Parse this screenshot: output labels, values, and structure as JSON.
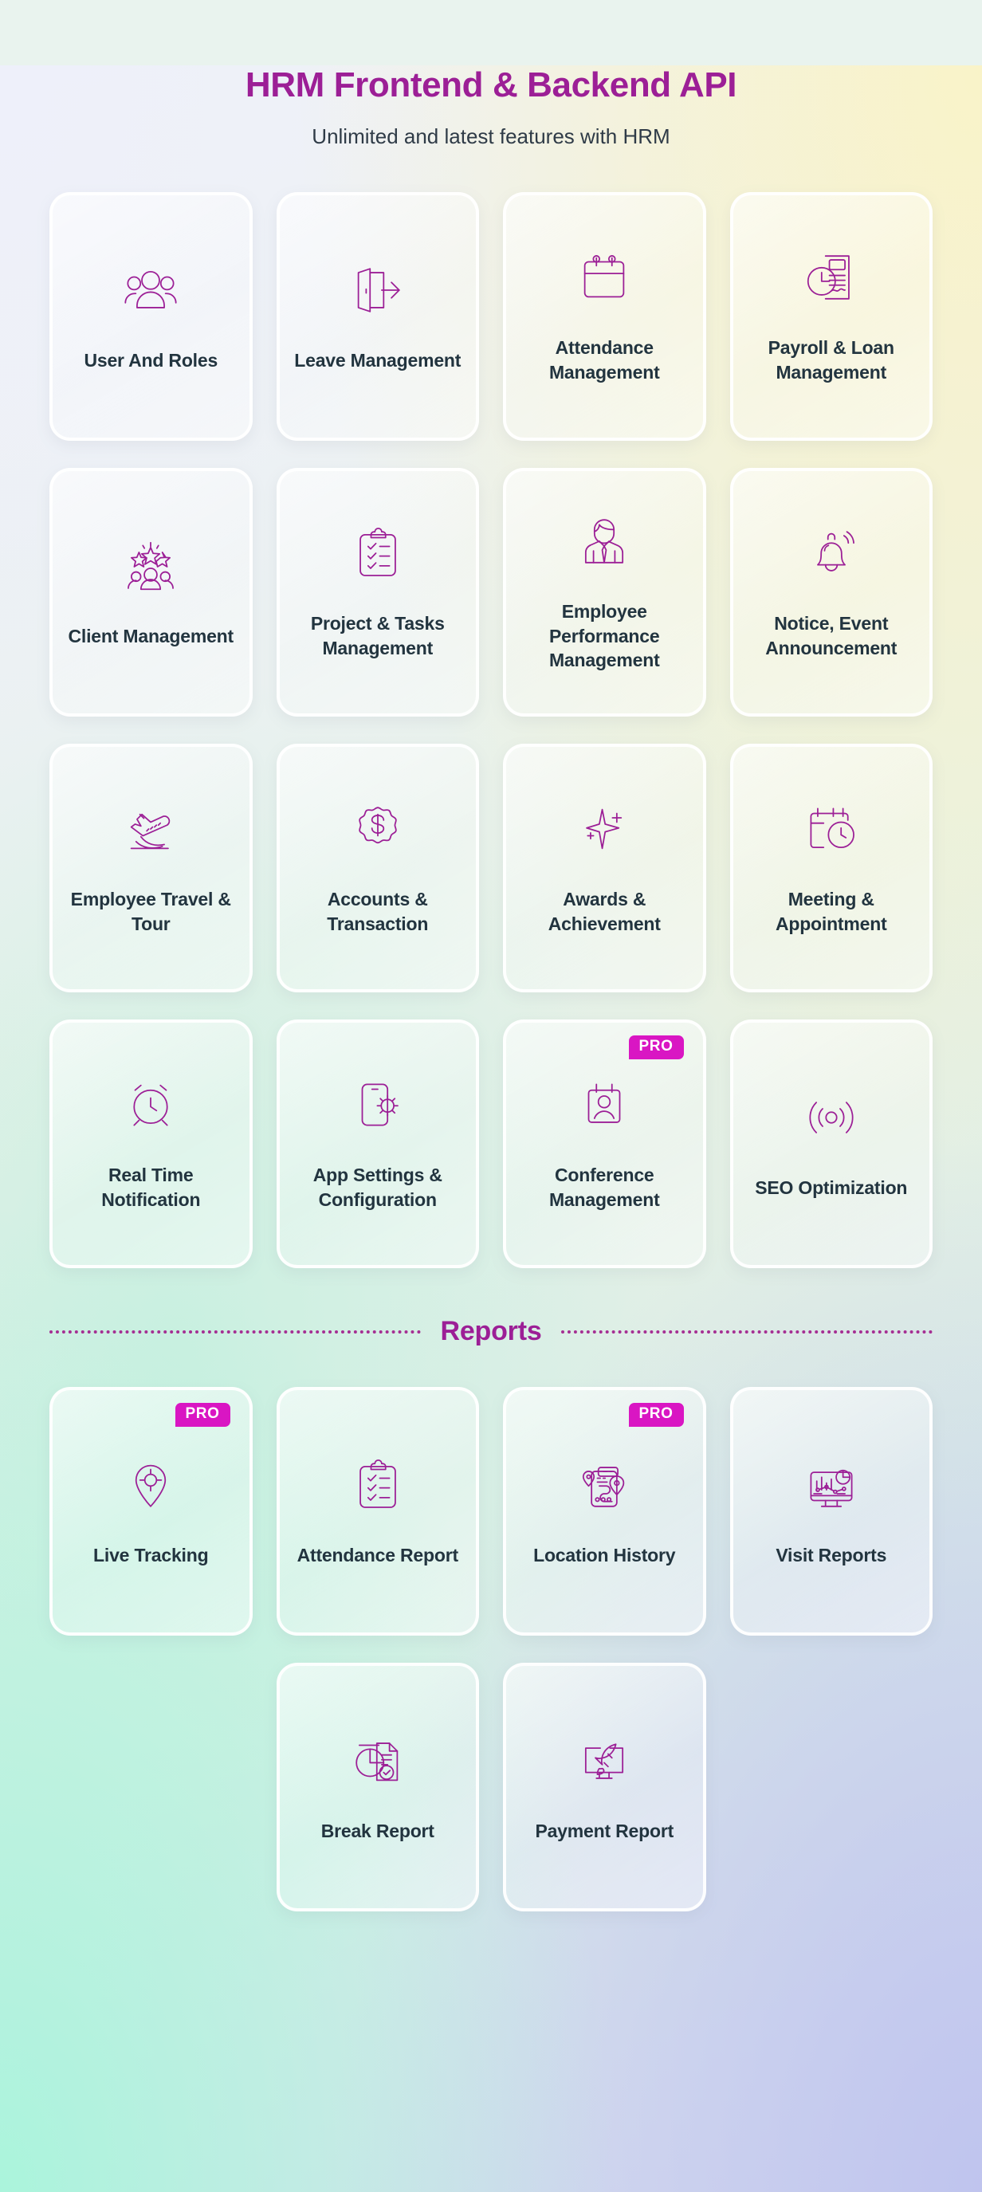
{
  "header": {
    "title": "HRM Frontend & Backend API",
    "subtitle": "Unlimited and latest features with HRM"
  },
  "colors": {
    "accent_purple": "#9c1f96",
    "pro_badge": "#d916c3",
    "label_text": "#22343f",
    "subtitle_text": "#2f3b47",
    "card_border": "#ffffff"
  },
  "badges": {
    "pro": "PRO"
  },
  "features": [
    {
      "label": "User And Roles",
      "icon": "users-group-icon",
      "pro": false
    },
    {
      "label": "Leave Management",
      "icon": "door-exit-icon",
      "pro": false
    },
    {
      "label": "Attendance Management",
      "icon": "calendar-icon",
      "pro": false
    },
    {
      "label": "Payroll & Loan Management",
      "icon": "loan-document-clock-icon",
      "pro": false
    },
    {
      "label": "Client Management",
      "icon": "stars-people-icon",
      "pro": false
    },
    {
      "label": "Project & Tasks Management",
      "icon": "clipboard-checklist-icon",
      "pro": false
    },
    {
      "label": "Employee Performance Management",
      "icon": "employee-suit-icon",
      "pro": false
    },
    {
      "label": "Notice, Event Announcement",
      "icon": "bell-ring-icon",
      "pro": false
    },
    {
      "label": "Employee Travel & Tour",
      "icon": "airplane-landing-icon",
      "pro": false
    },
    {
      "label": "Accounts & Transaction",
      "icon": "dollar-badge-icon",
      "pro": false
    },
    {
      "label": "Awards & Achievement",
      "icon": "sparkle-star-icon",
      "pro": false
    },
    {
      "label": "Meeting & Appointment",
      "icon": "calendar-clock-icon",
      "pro": false
    },
    {
      "label": "Real Time Notification",
      "icon": "alarm-clock-icon",
      "pro": false
    },
    {
      "label": "App Settings & Configuration",
      "icon": "phone-gear-icon",
      "pro": false
    },
    {
      "label": "Conference Management",
      "icon": "badge-person-icon",
      "pro": true
    },
    {
      "label": "SEO Optimization",
      "icon": "broadcast-signal-icon",
      "pro": false
    }
  ],
  "reports_section": {
    "title": "Reports"
  },
  "reports": [
    {
      "label": "Live Tracking",
      "icon": "map-pin-target-icon",
      "pro": true
    },
    {
      "label": "Attendance Report",
      "icon": "clipboard-checklist-icon",
      "pro": false
    },
    {
      "label": "Location History",
      "icon": "phone-route-pin-icon",
      "pro": true
    },
    {
      "label": "Visit Reports",
      "icon": "monitor-analytics-icon",
      "pro": false
    },
    {
      "label": "Break Report",
      "icon": "pie-document-check-icon",
      "pro": false
    },
    {
      "label": "Payment Report",
      "icon": "monitor-rocket-icon",
      "pro": false
    }
  ]
}
